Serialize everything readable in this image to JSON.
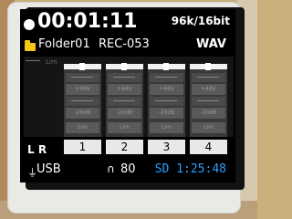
{
  "status_bar": {
    "timecode": "00:01:11",
    "format": "96k/16bit"
  },
  "file_bar": {
    "folder": "Folder01",
    "file": "REC-053",
    "type": "WAV"
  },
  "mixer": {
    "header_hint": "Lim",
    "channels": [
      {
        "label": "1",
        "phantom": "+48V",
        "pad": "-20dB",
        "limiter": "Lim"
      },
      {
        "label": "2",
        "phantom": "+48V",
        "pad": "-20dB",
        "limiter": "Lim"
      },
      {
        "label": "3",
        "phantom": "+48V",
        "pad": "-20dB",
        "limiter": "Lim"
      },
      {
        "label": "4",
        "phantom": "+48V",
        "pad": "-20dB",
        "limiter": "Lim"
      }
    ],
    "lr_label": "L R"
  },
  "bottom_bar": {
    "power": "USB",
    "headphone_level": "80",
    "remaining": "SD 1:25:48"
  },
  "icons": {
    "record": "record-indicator-icon",
    "folder": "folder-icon",
    "usb": "usb-power-icon",
    "headphone": "headphone-icon"
  },
  "colors": {
    "screen_bg": "#000000",
    "text": "#ffffff",
    "folder_icon": "#f5c518",
    "sd_text": "#2aa0ff",
    "tab_bg": "#e8e8e8"
  }
}
